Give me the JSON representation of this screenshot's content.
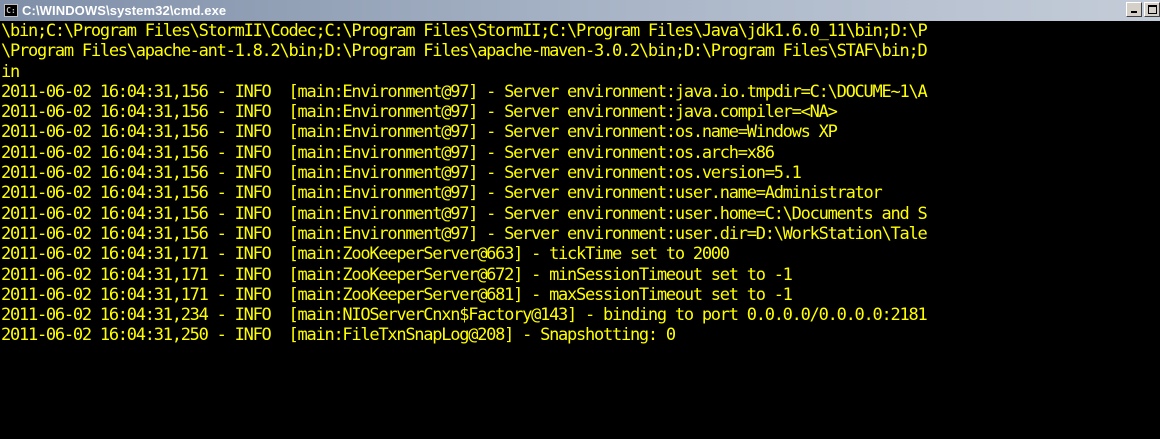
{
  "window": {
    "title": "C:\\WINDOWS\\system32\\cmd.exe",
    "icon": "console-icon",
    "buttons": [
      "minimize",
      "maximize"
    ]
  },
  "colors": {
    "text": "#ffff00",
    "background": "#000000",
    "titlebar": "#7f8fa8"
  },
  "console": {
    "lines": [
      "\\bin;C:\\Program Files\\StormII\\Codec;C:\\Program Files\\StormII;C:\\Program Files\\Java\\jdk1.6.0_11\\bin;D:\\P",
      "\\Program Files\\apache-ant-1.8.2\\bin;D:\\Program Files\\apache-maven-3.0.2\\bin;D:\\Program Files\\STAF\\bin;D",
      "in",
      "2011-06-02 16:04:31,156 - INFO  [main:Environment@97] - Server environment:java.io.tmpdir=C:\\DOCUME~1\\A",
      "2011-06-02 16:04:31,156 - INFO  [main:Environment@97] - Server environment:java.compiler=<NA>",
      "2011-06-02 16:04:31,156 - INFO  [main:Environment@97] - Server environment:os.name=Windows XP",
      "2011-06-02 16:04:31,156 - INFO  [main:Environment@97] - Server environment:os.arch=x86",
      "2011-06-02 16:04:31,156 - INFO  [main:Environment@97] - Server environment:os.version=5.1",
      "2011-06-02 16:04:31,156 - INFO  [main:Environment@97] - Server environment:user.name=Administrator",
      "2011-06-02 16:04:31,156 - INFO  [main:Environment@97] - Server environment:user.home=C:\\Documents and S",
      "2011-06-02 16:04:31,156 - INFO  [main:Environment@97] - Server environment:user.dir=D:\\WorkStation\\Tale",
      "2011-06-02 16:04:31,171 - INFO  [main:ZooKeeperServer@663] - tickTime set to 2000",
      "2011-06-02 16:04:31,171 - INFO  [main:ZooKeeperServer@672] - minSessionTimeout set to -1",
      "2011-06-02 16:04:31,171 - INFO  [main:ZooKeeperServer@681] - maxSessionTimeout set to -1",
      "2011-06-02 16:04:31,234 - INFO  [main:NIOServerCnxn$Factory@143] - binding to port 0.0.0.0/0.0.0.0:2181",
      "2011-06-02 16:04:31,250 - INFO  [main:FileTxnSnapLog@208] - Snapshotting: 0"
    ]
  }
}
